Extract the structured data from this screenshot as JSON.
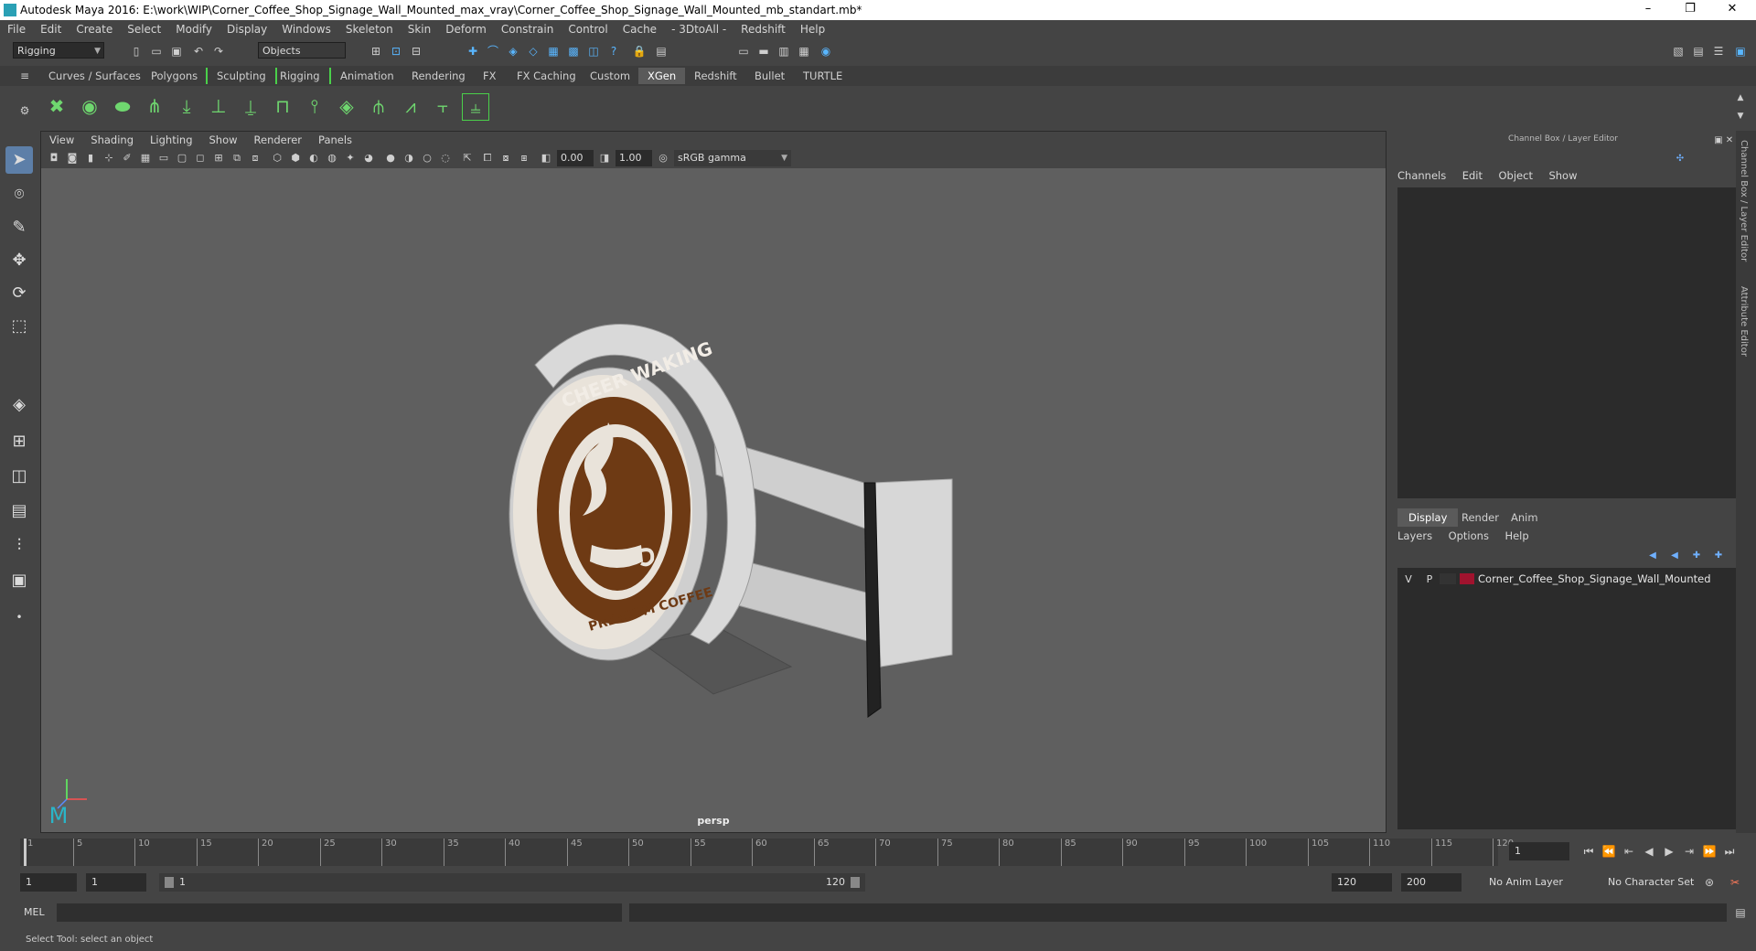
{
  "window": {
    "title": "Autodesk Maya 2016: E:\\work\\WIP\\Corner_Coffee_Shop_Signage_Wall_Mounted_max_vray\\Corner_Coffee_Shop_Signage_Wall_Mounted_mb_standart.mb*",
    "minimize": "–",
    "restore": "❐",
    "close": "✕"
  },
  "menu": [
    "File",
    "Edit",
    "Create",
    "Select",
    "Modify",
    "Display",
    "Windows",
    "Skeleton",
    "Skin",
    "Deform",
    "Constrain",
    "Control",
    "Cache",
    "- 3DtoAll -",
    "Redshift",
    "Help"
  ],
  "statusline": {
    "mode": "Rigging",
    "objects": "Objects"
  },
  "shelf_tabs": [
    "Curves / Surfaces",
    "Polygons",
    "Sculpting",
    "Rigging",
    "Animation",
    "Rendering",
    "FX",
    "FX Caching",
    "Custom",
    "XGen",
    "Redshift",
    "Bullet",
    "TURTLE"
  ],
  "active_shelf": "XGen",
  "viewport": {
    "menu": [
      "View",
      "Shading",
      "Lighting",
      "Show",
      "Renderer",
      "Panels"
    ],
    "exposure": "0.00",
    "gamma": "1.00",
    "colorspace": "sRGB gamma",
    "camera": "persp",
    "sign_top_text": "CHEER WAKING",
    "sign_bottom_text": "PREMIUM COFFEE"
  },
  "channel_box": {
    "title": "Channel Box / Layer Editor",
    "menu": [
      "Channels",
      "Edit",
      "Object",
      "Show"
    ],
    "layer_tabs": [
      "Display",
      "Render",
      "Anim"
    ],
    "active_layer_tab": "Display",
    "layer_menu": [
      "Layers",
      "Options",
      "Help"
    ],
    "layer": {
      "v": "V",
      "p": "P",
      "name": "Corner_Coffee_Shop_Signage_Wall_Mounted",
      "color": "#a0132e"
    },
    "side_tabs": [
      "Channel Box / Layer Editor",
      "Attribute Editor"
    ]
  },
  "timeline": {
    "ticks": [
      1,
      5,
      10,
      15,
      20,
      25,
      30,
      35,
      40,
      45,
      50,
      55,
      60,
      65,
      70,
      75,
      80,
      85,
      90,
      95,
      100,
      105,
      110,
      115,
      120
    ],
    "current_frame": "1"
  },
  "range": {
    "start": "1",
    "playback_start": "1",
    "slider_start": "1",
    "slider_end": "120",
    "playback_end": "120",
    "end": "200",
    "anim_layer": "No Anim Layer",
    "char_set": "No Character Set"
  },
  "cmdline": {
    "label": "MEL"
  },
  "helpline": "Select Tool: select an object",
  "colors": {
    "accent": "#5d7fa8",
    "shelf_icon": "#6fd76f",
    "sign_brown": "#6e3a14",
    "sign_ring": "#e9e3da"
  }
}
